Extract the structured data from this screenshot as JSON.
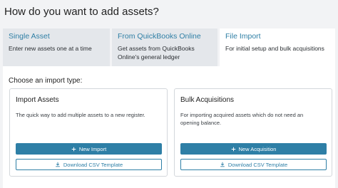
{
  "page": {
    "title": "How do you want to add assets?"
  },
  "tabs": [
    {
      "title": "Single Asset",
      "desc": "Enter new assets one at a time"
    },
    {
      "title": "From QuickBooks Online",
      "desc": "Get assets from QuickBooks Online's general ledger"
    },
    {
      "title": "File Import",
      "desc": "For initial setup and bulk acquisitions"
    }
  ],
  "panel": {
    "label": "Choose an import type:",
    "cards": [
      {
        "title": "Import Assets",
        "desc": "The quick way to add multiple assets to a new register.",
        "primary_label": "New Import",
        "secondary_label": "Download CSV Template"
      },
      {
        "title": "Bulk Acquisitions",
        "desc": "For importing acquired assets which do not need an opening balance.",
        "primary_label": "New Acquisition",
        "secondary_label": "Download CSV Template"
      }
    ]
  },
  "icons": {
    "plus": "plus-icon",
    "download": "download-icon"
  },
  "colors": {
    "accent": "#2e7fa6",
    "background": "#f2f3f5",
    "tab_inactive": "#e4e7eb"
  }
}
